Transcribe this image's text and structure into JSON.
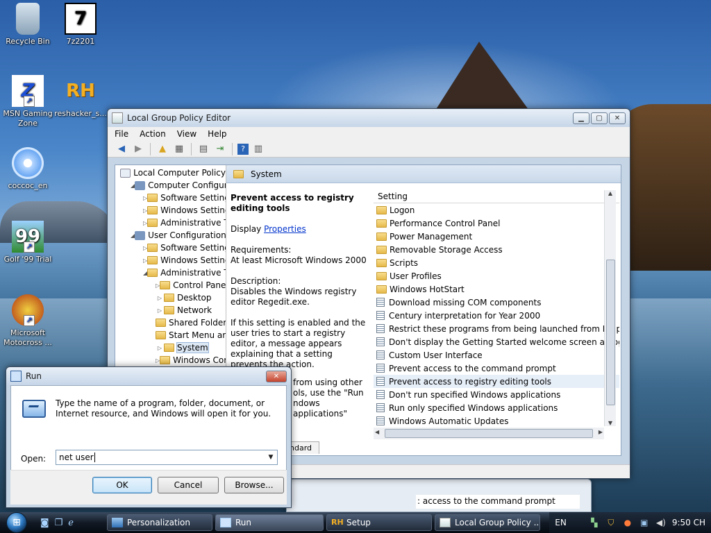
{
  "desktop": {
    "icons": [
      {
        "label": "Recycle Bin",
        "icon": "recycle-bin-icon"
      },
      {
        "label": "7z2201",
        "icon": "archive-installer-icon"
      },
      {
        "label": "MSN Gaming Zone",
        "icon": "msn-zone-icon"
      },
      {
        "label": "reshacker_s...",
        "icon": "resource-hacker-icon"
      },
      {
        "label": "coccoc_en",
        "icon": "cd-installer-icon"
      },
      {
        "label": "Golf '99 Trial",
        "icon": "golf-game-icon"
      },
      {
        "label": "Microsoft Motocross ...",
        "icon": "motocross-game-icon"
      }
    ]
  },
  "gpe": {
    "title": "Local Group Policy Editor",
    "menu": [
      "File",
      "Action",
      "View",
      "Help"
    ],
    "tree": [
      {
        "label": "Local Computer Policy",
        "indent": 0,
        "tw": "",
        "icon": "policy"
      },
      {
        "label": "Computer Configura",
        "indent": 1,
        "tw": "◢",
        "icon": "cfg"
      },
      {
        "label": "Software Settings",
        "indent": 2,
        "tw": "▷",
        "icon": "folder"
      },
      {
        "label": "Windows Setting",
        "indent": 2,
        "tw": "▷",
        "icon": "folder"
      },
      {
        "label": "Administrative Te",
        "indent": 2,
        "tw": "▷",
        "icon": "folder"
      },
      {
        "label": "User Configuration",
        "indent": 1,
        "tw": "◢",
        "icon": "cfg"
      },
      {
        "label": "Software Settings",
        "indent": 2,
        "tw": "▷",
        "icon": "folder"
      },
      {
        "label": "Windows Setting",
        "indent": 2,
        "tw": "▷",
        "icon": "folder"
      },
      {
        "label": "Administrative Te",
        "indent": 2,
        "tw": "◢",
        "icon": "folder"
      },
      {
        "label": "Control Panel",
        "indent": 3,
        "tw": "▷",
        "icon": "folder"
      },
      {
        "label": "Desktop",
        "indent": 3,
        "tw": "▷",
        "icon": "folder"
      },
      {
        "label": "Network",
        "indent": 3,
        "tw": "▷",
        "icon": "folder"
      },
      {
        "label": "Shared Folder",
        "indent": 3,
        "tw": "",
        "icon": "folder"
      },
      {
        "label": "Start Menu ar",
        "indent": 3,
        "tw": "",
        "icon": "folder"
      },
      {
        "label": "System",
        "indent": 3,
        "tw": "▷",
        "icon": "folder",
        "selected": true
      },
      {
        "label": "Windows Cor",
        "indent": 3,
        "tw": "▷",
        "icon": "folder"
      }
    ],
    "section_title": "System",
    "description": {
      "heading": "Prevent access to registry editing tools",
      "display_prefix": "Display",
      "display_link": "Properties",
      "requirements_label": "Requirements:",
      "requirements_value": "At least Microsoft Windows 2000",
      "description_label": "Description:",
      "description_value": "Disables the Windows registry editor Regedit.exe.",
      "detail": "If this setting is enabled and the user tries to start a registry editor, a message appears explaining that a setting prevents the action.",
      "fragment_1": "from using other",
      "fragment_2": "ols, use the \"Run",
      "fragment_3": "ndows applications\""
    },
    "settings_header": "Setting",
    "settings": [
      {
        "label": "Logon",
        "type": "folder"
      },
      {
        "label": "Performance Control Panel",
        "type": "folder"
      },
      {
        "label": "Power Management",
        "type": "folder"
      },
      {
        "label": "Removable Storage Access",
        "type": "folder"
      },
      {
        "label": "Scripts",
        "type": "folder"
      },
      {
        "label": "User Profiles",
        "type": "folder"
      },
      {
        "label": "Windows HotStart",
        "type": "folder"
      },
      {
        "label": "Download missing COM components",
        "type": "policy"
      },
      {
        "label": "Century interpretation for Year 2000",
        "type": "policy"
      },
      {
        "label": "Restrict these programs from being launched from Help",
        "type": "policy"
      },
      {
        "label": "Don't display the Getting Started welcome screen at logon",
        "type": "policy"
      },
      {
        "label": "Custom User Interface",
        "type": "policy"
      },
      {
        "label": "Prevent access to the command prompt",
        "type": "policy"
      },
      {
        "label": "Prevent access to registry editing tools",
        "type": "policy",
        "selected": true
      },
      {
        "label": "Don't run specified Windows applications",
        "type": "policy"
      },
      {
        "label": "Run only specified Windows applications",
        "type": "policy"
      },
      {
        "label": "Windows Automatic Updates",
        "type": "policy"
      }
    ],
    "tab_fragment": "ndard"
  },
  "background_window": {
    "text": ": access to the command prompt"
  },
  "run_dialog": {
    "title": "Run",
    "prompt": "Type the name of a program, folder, document, or Internet resource, and Windows will open it for you.",
    "open_label": "Open:",
    "open_value": "net user",
    "ok_label": "OK",
    "cancel_label": "Cancel",
    "browse_label": "Browse..."
  },
  "taskbar": {
    "tasks": [
      {
        "label": "Personalization",
        "icon": "personalization-icon"
      },
      {
        "label": "Run",
        "icon": "run-icon",
        "active": true
      },
      {
        "label": "Setup",
        "icon": "resource-hacker-icon"
      },
      {
        "label": "Local Group Policy ...",
        "icon": "group-policy-icon"
      }
    ],
    "language": "EN",
    "clock": "9:50 CH"
  },
  "colors": {
    "accent": "#2f7bc4",
    "link": "#0033cc",
    "selection": "#dde8f5"
  }
}
